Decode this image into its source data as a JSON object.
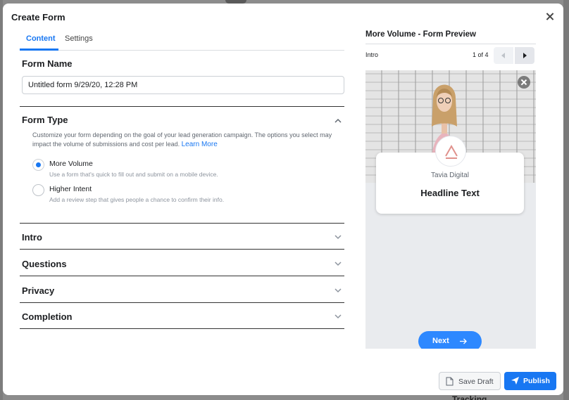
{
  "background": {
    "bottom_text": "Tracking"
  },
  "modal": {
    "title": "Create Form"
  },
  "tabs": [
    {
      "label": "Content",
      "active": true
    },
    {
      "label": "Settings",
      "active": false
    }
  ],
  "form_name": {
    "title": "Form Name",
    "value": "Untitled form 9/29/20, 12:28 PM"
  },
  "form_type": {
    "title": "Form Type",
    "description": "Customize your form depending on the goal of your lead generation campaign. The options you select may impact the volume of submissions and cost per lead.",
    "learn_more": "Learn More",
    "options": [
      {
        "label": "More Volume",
        "sub": "Use a form that's quick to fill out and submit on a mobile device.",
        "checked": true
      },
      {
        "label": "Higher Intent",
        "sub": "Add a review step that gives people a chance to confirm their info.",
        "checked": false
      }
    ]
  },
  "sections": [
    {
      "title": "Intro"
    },
    {
      "title": "Questions"
    },
    {
      "title": "Privacy"
    },
    {
      "title": "Completion"
    }
  ],
  "preview": {
    "title": "More Volume - Form Preview",
    "step_label": "Intro",
    "pager": "1 of 4",
    "company": "Tavia Digital",
    "headline": "Headline Text",
    "next_label": "Next"
  },
  "footer": {
    "save_draft": "Save Draft",
    "publish": "Publish"
  },
  "colors": {
    "accent": "#1877f2",
    "next_button": "#2d88ff",
    "logo": "#e0918c"
  }
}
